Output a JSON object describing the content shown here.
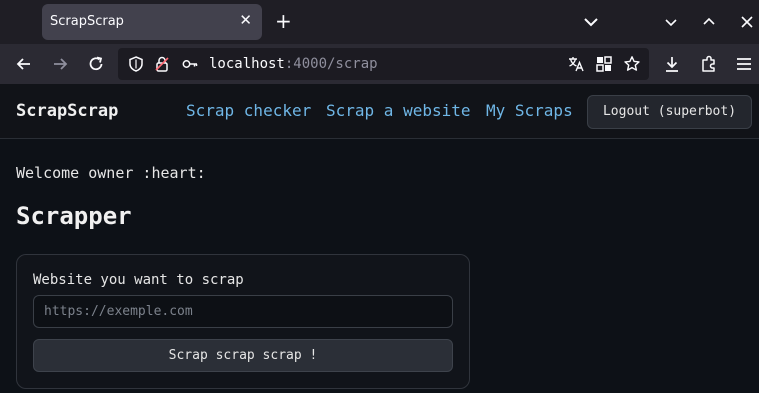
{
  "browser": {
    "tab_title": "ScrapScrap",
    "tab_close": "✕",
    "new_tab": "+",
    "url_host": "localhost",
    "url_path": ":4000/scrap"
  },
  "app": {
    "brand": "ScrapScrap",
    "nav": [
      "Scrap checker",
      "Scrap a website",
      "My Scraps"
    ],
    "logout_label": "Logout (superbot)",
    "link_color": "#6fb6e6"
  },
  "main": {
    "welcome": "Welcome owner :heart:",
    "title": "Scrapper",
    "form": {
      "label": "Website you want to scrap",
      "placeholder": "https://exemple.com",
      "value": "",
      "submit_label": "Scrap scrap scrap !"
    }
  },
  "icons": {
    "back": "arrow-left-icon",
    "forward": "arrow-right-icon",
    "reload": "reload-icon",
    "shield": "shield-icon",
    "permissions": "permissions-icon",
    "key": "key-icon",
    "translate": "translate-icon",
    "qr": "qr-code-icon",
    "bookmark": "star-icon",
    "download": "download-icon",
    "extensions": "puzzle-icon",
    "menu": "hamburger-menu-icon"
  }
}
